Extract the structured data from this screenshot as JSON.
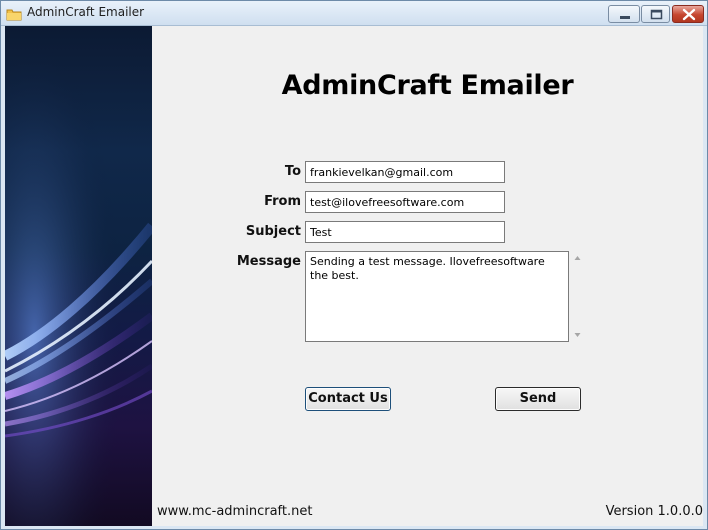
{
  "window": {
    "title": "AdminCraft Emailer",
    "icon": "envelope-folder-icon",
    "controls": {
      "minimize": "minimize-icon",
      "maximize": "maximize-icon",
      "close": "close-icon"
    }
  },
  "main": {
    "heading": "AdminCraft Emailer",
    "form": {
      "to_label": "To",
      "to_value": "frankievelkan@gmail.com",
      "from_label": "From",
      "from_value": "test@ilovefreesoftware.com",
      "subject_label": "Subject",
      "subject_value": "Test",
      "message_label": "Message",
      "message_value": "Sending a test message. Ilovefreesoftware the best."
    },
    "buttons": {
      "contact_label": "Contact Us",
      "send_label": "Send"
    }
  },
  "footer": {
    "website": "www.mc-admincraft.net",
    "version": "Version 1.0.0.0"
  },
  "colors": {
    "title_bar": "#cfdff0",
    "close_button": "#c6452f",
    "client_bg": "#f0f0f0",
    "side_art_dark": "#0c1a33",
    "side_art_glow": "#7fb0ff"
  }
}
